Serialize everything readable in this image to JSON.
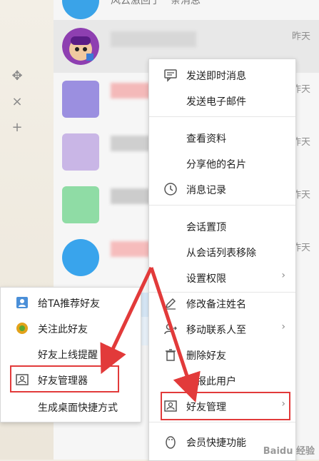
{
  "conversation_list": {
    "top_row_text": "风云激回了一条消息",
    "selected_row_time": "昨天",
    "row_times": [
      "昨天",
      "昨天",
      "昨天",
      "昨天"
    ]
  },
  "context_menu": {
    "items": [
      {
        "label": "发送即时消息",
        "icon": "chat-icon"
      },
      {
        "label": "发送电子邮件",
        "icon": ""
      },
      {
        "label": "查看资料",
        "icon": ""
      },
      {
        "label": "分享他的名片",
        "icon": ""
      },
      {
        "label": "消息记录",
        "icon": "clock-icon"
      },
      {
        "label": "会话置顶",
        "icon": ""
      },
      {
        "label": "从会话列表移除",
        "icon": ""
      },
      {
        "label": "设置权限",
        "icon": ""
      },
      {
        "label": "修改备注姓名",
        "icon": "pencil-icon"
      },
      {
        "label": "移动联系人至",
        "icon": ""
      },
      {
        "label": "删除好友",
        "icon": "trash-icon"
      },
      {
        "label": "举报此用户",
        "icon": ""
      },
      {
        "label": "好友管理",
        "icon": "contact-card-icon"
      },
      {
        "label": "会员快捷功能",
        "icon": "penguin-icon"
      }
    ]
  },
  "submenu": {
    "items": [
      {
        "label": "给TA推荐好友",
        "icon": "recommend-user-icon"
      },
      {
        "label": "关注此好友",
        "icon": "follow-icon"
      },
      {
        "label": "好友上线提醒",
        "icon": ""
      },
      {
        "label": "好友管理器",
        "icon": "contact-card-icon"
      },
      {
        "label": "生成桌面快捷方式",
        "icon": ""
      }
    ]
  },
  "left_toolbar": [
    "move-icon",
    "close-icon",
    "plus-icon"
  ],
  "watermark": "Baidu 经验",
  "colors": {
    "highlight_red": "#e23a3a",
    "menu_bg": "#ffffff"
  }
}
